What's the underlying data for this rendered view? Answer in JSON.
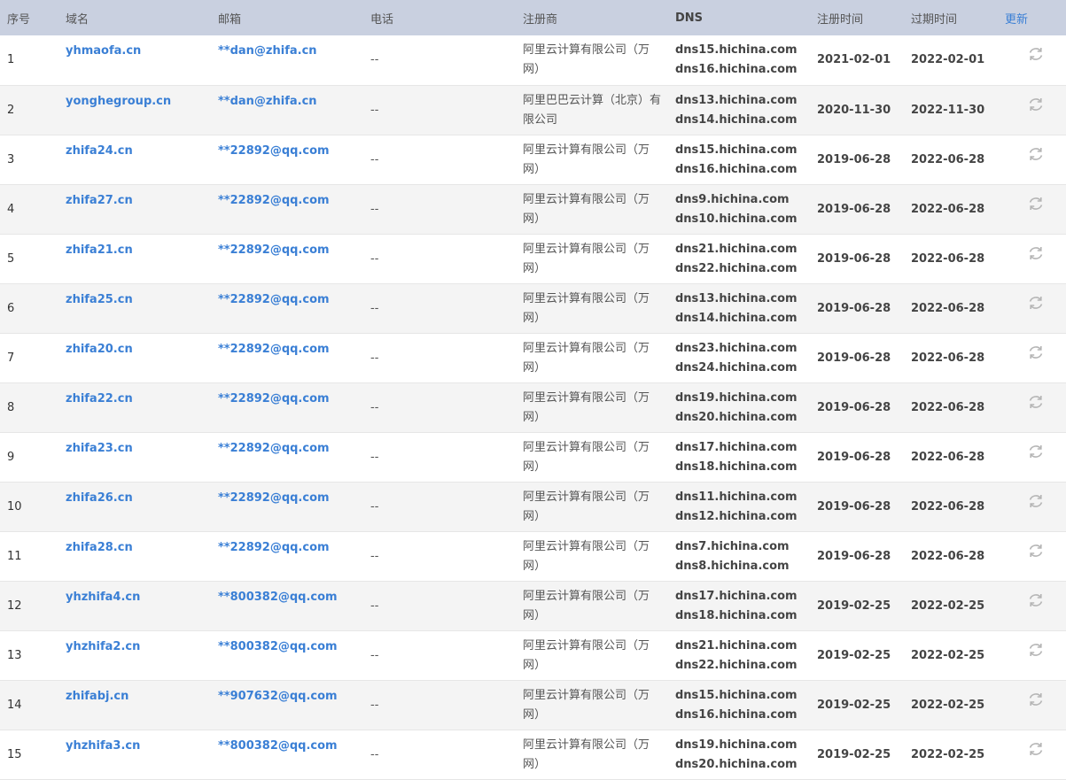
{
  "headers": {
    "index": "序号",
    "domain": "域名",
    "email": "邮箱",
    "phone": "电话",
    "registrar": "注册商",
    "dns": "DNS",
    "reg_date": "注册时间",
    "exp_date": "过期时间",
    "refresh": "更新"
  },
  "rows": [
    {
      "index": "1",
      "domain": "yhmaofa.cn",
      "email": "**dan@zhifa.cn",
      "phone": "--",
      "registrar": "阿里云计算有限公司（万网）",
      "dns1": "dns15.hichina.com",
      "dns2": "dns16.hichina.com",
      "reg": "2021-02-01",
      "exp": "2022-02-01"
    },
    {
      "index": "2",
      "domain": "yonghegroup.cn",
      "email": "**dan@zhifa.cn",
      "phone": "--",
      "registrar": "阿里巴巴云计算（北京）有限公司",
      "dns1": "dns13.hichina.com",
      "dns2": "dns14.hichina.com",
      "reg": "2020-11-30",
      "exp": "2022-11-30"
    },
    {
      "index": "3",
      "domain": "zhifa24.cn",
      "email": "**22892@qq.com",
      "phone": "--",
      "registrar": "阿里云计算有限公司（万网）",
      "dns1": "dns15.hichina.com",
      "dns2": "dns16.hichina.com",
      "reg": "2019-06-28",
      "exp": "2022-06-28"
    },
    {
      "index": "4",
      "domain": "zhifa27.cn",
      "email": "**22892@qq.com",
      "phone": "--",
      "registrar": "阿里云计算有限公司（万网）",
      "dns1": "dns9.hichina.com",
      "dns2": "dns10.hichina.com",
      "reg": "2019-06-28",
      "exp": "2022-06-28"
    },
    {
      "index": "5",
      "domain": "zhifa21.cn",
      "email": "**22892@qq.com",
      "phone": "--",
      "registrar": "阿里云计算有限公司（万网）",
      "dns1": "dns21.hichina.com",
      "dns2": "dns22.hichina.com",
      "reg": "2019-06-28",
      "exp": "2022-06-28"
    },
    {
      "index": "6",
      "domain": "zhifa25.cn",
      "email": "**22892@qq.com",
      "phone": "--",
      "registrar": "阿里云计算有限公司（万网）",
      "dns1": "dns13.hichina.com",
      "dns2": "dns14.hichina.com",
      "reg": "2019-06-28",
      "exp": "2022-06-28"
    },
    {
      "index": "7",
      "domain": "zhifa20.cn",
      "email": "**22892@qq.com",
      "phone": "--",
      "registrar": "阿里云计算有限公司（万网）",
      "dns1": "dns23.hichina.com",
      "dns2": "dns24.hichina.com",
      "reg": "2019-06-28",
      "exp": "2022-06-28"
    },
    {
      "index": "8",
      "domain": "zhifa22.cn",
      "email": "**22892@qq.com",
      "phone": "--",
      "registrar": "阿里云计算有限公司（万网）",
      "dns1": "dns19.hichina.com",
      "dns2": "dns20.hichina.com",
      "reg": "2019-06-28",
      "exp": "2022-06-28"
    },
    {
      "index": "9",
      "domain": "zhifa23.cn",
      "email": "**22892@qq.com",
      "phone": "--",
      "registrar": "阿里云计算有限公司（万网）",
      "dns1": "dns17.hichina.com",
      "dns2": "dns18.hichina.com",
      "reg": "2019-06-28",
      "exp": "2022-06-28"
    },
    {
      "index": "10",
      "domain": "zhifa26.cn",
      "email": "**22892@qq.com",
      "phone": "--",
      "registrar": "阿里云计算有限公司（万网）",
      "dns1": "dns11.hichina.com",
      "dns2": "dns12.hichina.com",
      "reg": "2019-06-28",
      "exp": "2022-06-28"
    },
    {
      "index": "11",
      "domain": "zhifa28.cn",
      "email": "**22892@qq.com",
      "phone": "--",
      "registrar": "阿里云计算有限公司（万网）",
      "dns1": "dns7.hichina.com",
      "dns2": "dns8.hichina.com",
      "reg": "2019-06-28",
      "exp": "2022-06-28"
    },
    {
      "index": "12",
      "domain": "yhzhifa4.cn",
      "email": "**800382@qq.com",
      "phone": "--",
      "registrar": "阿里云计算有限公司（万网）",
      "dns1": "dns17.hichina.com",
      "dns2": "dns18.hichina.com",
      "reg": "2019-02-25",
      "exp": "2022-02-25"
    },
    {
      "index": "13",
      "domain": "yhzhifa2.cn",
      "email": "**800382@qq.com",
      "phone": "--",
      "registrar": "阿里云计算有限公司（万网）",
      "dns1": "dns21.hichina.com",
      "dns2": "dns22.hichina.com",
      "reg": "2019-02-25",
      "exp": "2022-02-25"
    },
    {
      "index": "14",
      "domain": "zhifabj.cn",
      "email": "**907632@qq.com",
      "phone": "--",
      "registrar": "阿里云计算有限公司（万网）",
      "dns1": "dns15.hichina.com",
      "dns2": "dns16.hichina.com",
      "reg": "2019-02-25",
      "exp": "2022-02-25"
    },
    {
      "index": "15",
      "domain": "yhzhifa3.cn",
      "email": "**800382@qq.com",
      "phone": "--",
      "registrar": "阿里云计算有限公司（万网）",
      "dns1": "dns19.hichina.com",
      "dns2": "dns20.hichina.com",
      "reg": "2019-02-25",
      "exp": "2022-02-25"
    }
  ],
  "icons": {
    "refresh": "refresh-icon"
  },
  "colors": {
    "header_bg": "#c9d0e0",
    "link": "#3a7fd5",
    "alt_row": "#f4f4f4"
  }
}
